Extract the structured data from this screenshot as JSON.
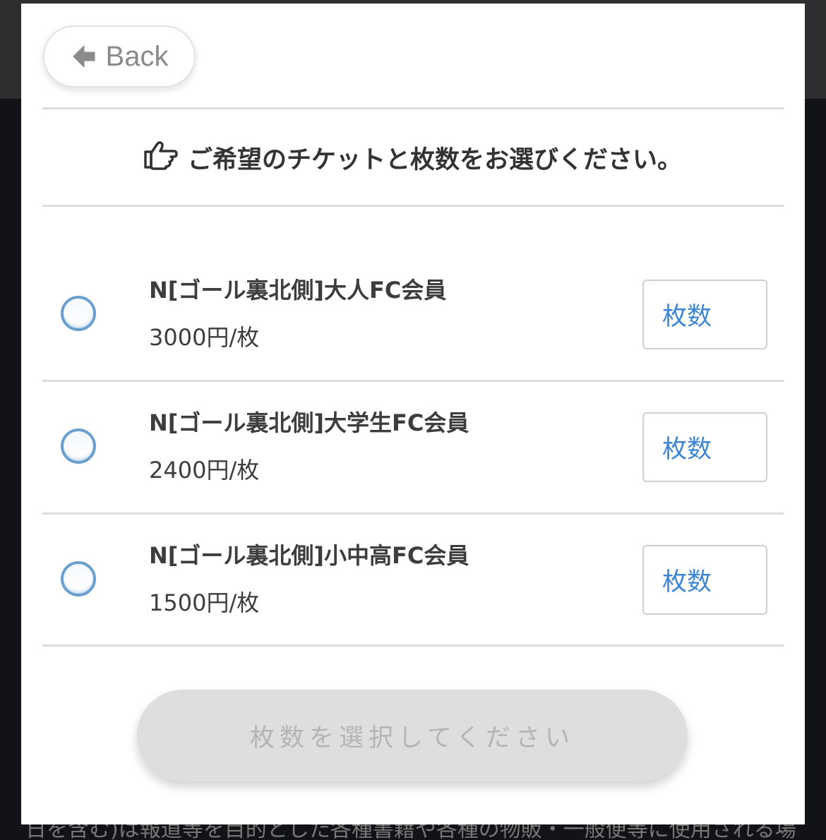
{
  "background": {
    "overlay_text": "日を含む)は報道等を目的とした各種書籍や各種の物販・一般便等に使用される場"
  },
  "modal": {
    "back_label": "Back",
    "back_icon": "arrow-left-icon",
    "instruction_icon": "hand-pointing-right-icon",
    "instruction": "ご希望のチケットと枚数をお選びください。",
    "tickets": [
      {
        "name": "N[ゴール裏北側]大人FC会員",
        "price": "3000円/枚",
        "quantity_placeholder": "枚数",
        "selected": false
      },
      {
        "name": "N[ゴール裏北側]大学生FC会員",
        "price": "2400円/枚",
        "quantity_placeholder": "枚数",
        "selected": false
      },
      {
        "name": "N[ゴール裏北側]小中高FC会員",
        "price": "1500円/枚",
        "quantity_placeholder": "枚数",
        "selected": false
      }
    ],
    "submit_label": "枚数を選択してください",
    "colors": {
      "accent_blue": "#3d85d6",
      "radio_border": "#6a9fcf",
      "disabled_button": "#dedede"
    }
  }
}
